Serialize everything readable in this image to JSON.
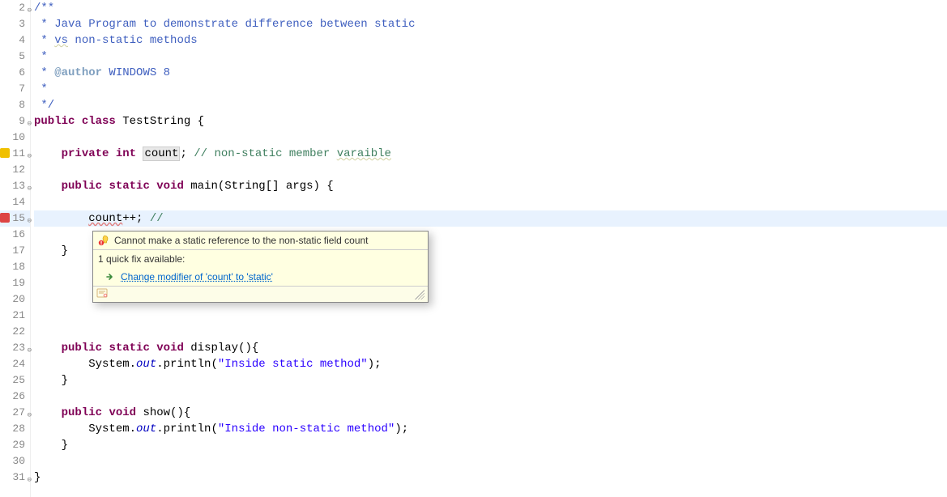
{
  "gutter": {
    "start": 2,
    "end": 31,
    "foldable": [
      2,
      9,
      11,
      13,
      15,
      23,
      27,
      31
    ],
    "warn": [
      11
    ],
    "error": [
      15
    ]
  },
  "code": {
    "l2": {
      "pre": "",
      "doc": "/**"
    },
    "l3": {
      "pre": " ",
      "doc": "* Java Program to demonstrate difference between static"
    },
    "l4": {
      "pre": " ",
      "doc": "* ",
      "sq": "vs",
      "doc2": " non-static methods"
    },
    "l5": {
      "pre": " ",
      "doc": "*"
    },
    "l6": {
      "pre": " ",
      "doc": "* ",
      "tag": "@author",
      "rest": " WINDOWS 8"
    },
    "l7": {
      "pre": " ",
      "doc": "*"
    },
    "l8": {
      "pre": " ",
      "doc": "*/"
    },
    "l9": {
      "kw1": "public",
      "kw2": "class",
      "name": " TestString {"
    },
    "l11": {
      "indent": "    ",
      "kw1": "private",
      "kw2": "int",
      "field": "count",
      "rest": "; ",
      "comment": "// non-static member ",
      "sq": "varaible"
    },
    "l13": {
      "indent": "    ",
      "kw1": "public",
      "kw2": "static",
      "kw3": "void",
      "name": " main(String[] args) {"
    },
    "l15": {
      "indent": "        ",
      "err": "count",
      "post": "++; ",
      "comment": "// "
    },
    "l16": {
      "indent": "        "
    },
    "l17": {
      "indent": "    }",
      "rest": ""
    },
    "l23": {
      "indent": "    ",
      "kw1": "public",
      "kw2": "static",
      "kw3": "void",
      "name": " display(){"
    },
    "l24": {
      "indent": "        System.",
      "it": "out",
      "mid": ".println(",
      "str": "\"Inside static method\"",
      "end": ");"
    },
    "l25": {
      "indent": "    }"
    },
    "l27": {
      "indent": "    ",
      "kw1": "public",
      "kw2": "void",
      "name": " show(){"
    },
    "l28": {
      "indent": "        System.",
      "it": "out",
      "mid": ".println(",
      "str": "\"Inside non-static method\"",
      "end": ");"
    },
    "l29": {
      "indent": "    }"
    },
    "l31": {
      "text": "}"
    }
  },
  "tooltip": {
    "error_msg": "Cannot make a static reference to the non-static field count",
    "quickfix_header": "1 quick fix available:",
    "quickfix_link": "Change modifier of 'count' to 'static'"
  }
}
